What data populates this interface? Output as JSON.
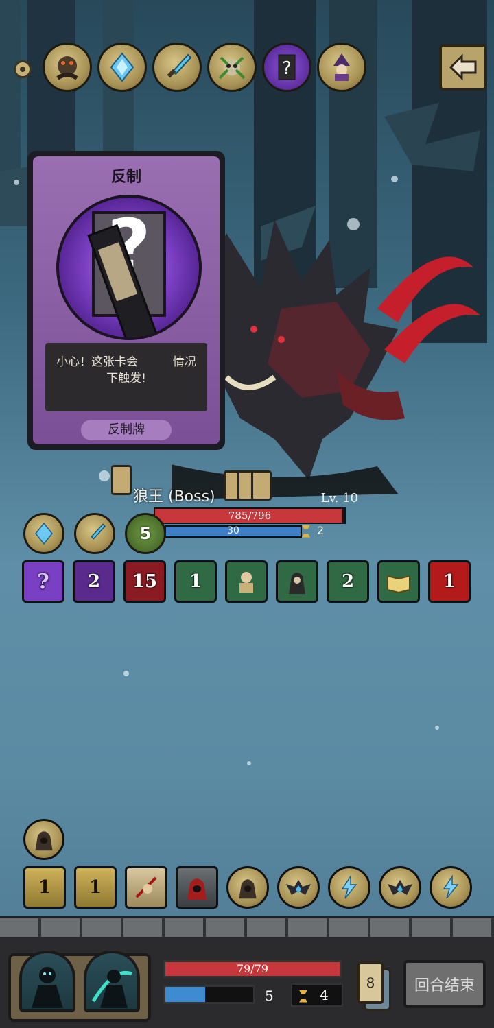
{
  "top_relics": [
    "rat-king-relic-icon",
    "ice-crystal-relic-icon",
    "ice-dagger-relic-icon",
    "thorn-skull-relic-icon",
    "mystery-relic-icon",
    "witch-relic-icon"
  ],
  "counter_card": {
    "title": "反制",
    "description_line1": "小心！这张卡会",
    "description_line1b": "情况",
    "description_line2": "下触发!",
    "type_label": "反制牌"
  },
  "boss": {
    "name": "狼王 (Boss)",
    "level": "Lv. 10",
    "hp_text": "785/796",
    "hp_fraction": 0.986,
    "shield_text": "30",
    "shield_fraction": 1.0,
    "timer": "2",
    "buffs": [
      {
        "icon": "ice-crystal-buff-icon",
        "value": ""
      },
      {
        "icon": "ice-dagger-buff-icon",
        "value": ""
      },
      {
        "icon": "thorn-buff-icon",
        "value": "5"
      }
    ],
    "intents": [
      {
        "icon": "mystery-intent-icon",
        "value": "",
        "color": "#7a3fc2"
      },
      {
        "icon": "eye-intent-icon",
        "value": "2",
        "color": "#5a2a8c"
      },
      {
        "icon": "blood-intent-icon",
        "value": "15",
        "color": "#8a1b22"
      },
      {
        "icon": "poison-skull-intent-icon",
        "value": "1",
        "color": "#2f6a44"
      },
      {
        "icon": "scholar-intent-icon",
        "value": "",
        "color": "#2f6a44"
      },
      {
        "icon": "hooded-figure-intent-icon",
        "value": "",
        "color": "#2f6a44"
      },
      {
        "icon": "traveler-intent-icon",
        "value": "2",
        "color": "#2f6a44"
      },
      {
        "icon": "spellbook-intent-icon",
        "value": "",
        "color": "#2f6a44"
      },
      {
        "icon": "red-rune-intent-icon",
        "value": "1",
        "color": "#b31b1b"
      }
    ]
  },
  "player": {
    "hp_text": "79/79",
    "hp_fraction": 1.0,
    "mana_fraction": 0.45,
    "energy": "5",
    "timer": "4",
    "deck_count": "8",
    "end_turn_label": "回合结束",
    "extra_buff": "hood-buff-icon",
    "buffs": [
      {
        "icon": "boot-buff-icon",
        "value": "1",
        "shape": "sq"
      },
      {
        "icon": "boot-buff-icon",
        "value": "1",
        "shape": "sq"
      },
      {
        "icon": "slash-buff-icon",
        "value": "",
        "shape": "sq"
      },
      {
        "icon": "red-hood-buff-icon",
        "value": "",
        "shape": "sq"
      },
      {
        "icon": "hood-buff-icon",
        "value": "",
        "shape": "rd"
      },
      {
        "icon": "bat-buff-icon",
        "value": "",
        "shape": "rd"
      },
      {
        "icon": "lightning-buff-icon",
        "value": "",
        "shape": "rd"
      },
      {
        "icon": "bat-buff-icon",
        "value": "",
        "shape": "rd"
      },
      {
        "icon": "lightning-buff-icon",
        "value": "",
        "shape": "rd"
      }
    ]
  }
}
